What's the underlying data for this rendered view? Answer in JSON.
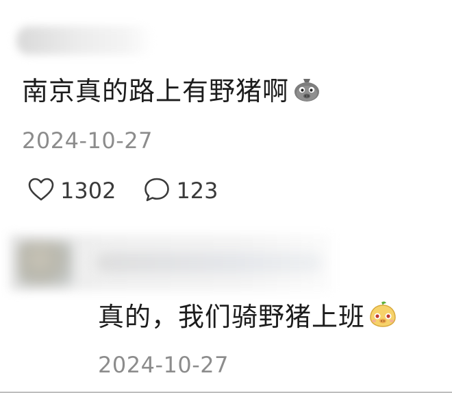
{
  "comment": {
    "text": "南京真的路上有野猪啊",
    "emoji": "boar-sticker-icon",
    "date": "2024-10-27",
    "likes": "1302",
    "replies": "123"
  },
  "reply": {
    "text": "真的，我们骑野猪上班",
    "emoji": "cute-boar-face-icon",
    "date": "2024-10-27"
  },
  "colors": {
    "text": "#1c1c1c",
    "meta": "#8c8c8c",
    "icon": "#3a3a3a"
  }
}
